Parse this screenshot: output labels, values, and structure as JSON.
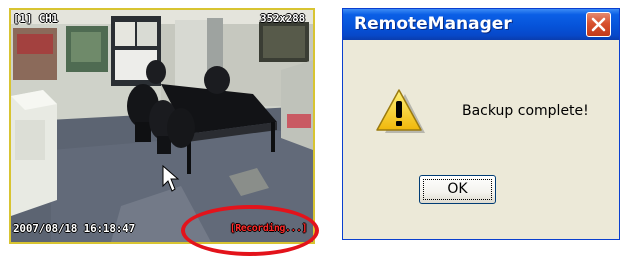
{
  "camera": {
    "channel_label": "[1] CH1",
    "resolution": "352x288",
    "timestamp": "2007/08/18 16:18:47",
    "recording_status": "[Recording...]",
    "border_color": "#d8c431",
    "highlight_color": "#e3131b"
  },
  "dialog": {
    "title": "RemoteManager",
    "message": "Backup complete!",
    "ok_label": "OK",
    "icon": "warning-icon",
    "close_icon": "close-icon",
    "titlebar_color": "#0653d9",
    "background_color": "#ece9d8"
  }
}
